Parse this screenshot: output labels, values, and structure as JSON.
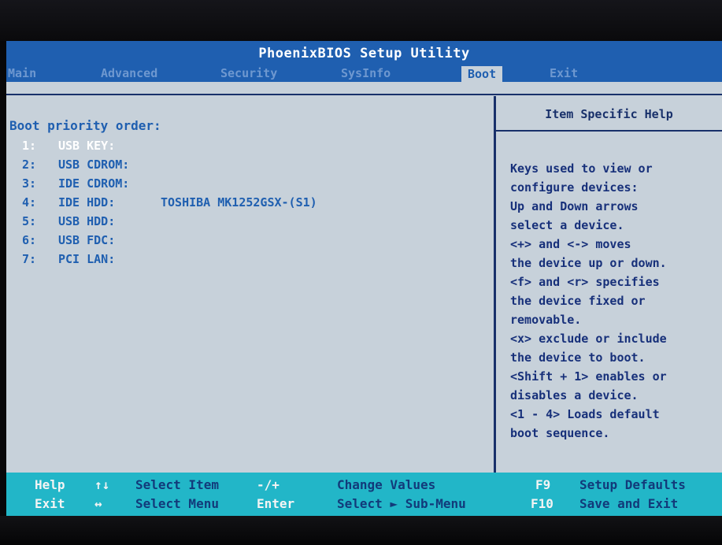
{
  "title": "PhoenixBIOS Setup Utility",
  "tabs": [
    "Main",
    "Advanced",
    "Security",
    "SysInfo",
    "Boot",
    "Exit"
  ],
  "active_tab": "Boot",
  "boot": {
    "heading": "Boot priority order:",
    "items": [
      {
        "num": "1:",
        "device": "USB KEY:",
        "detail": ""
      },
      {
        "num": "2:",
        "device": "USB CDROM:",
        "detail": ""
      },
      {
        "num": "3:",
        "device": "IDE CDROM:",
        "detail": ""
      },
      {
        "num": "4:",
        "device": "IDE HDD:",
        "detail": "TOSHIBA MK1252GSX-(S1)"
      },
      {
        "num": "5:",
        "device": "USB HDD:",
        "detail": ""
      },
      {
        "num": "6:",
        "device": "USB FDC:",
        "detail": ""
      },
      {
        "num": "7:",
        "device": "PCI LAN:",
        "detail": ""
      }
    ]
  },
  "help": {
    "title": "Item Specific Help",
    "text": "Keys used to view or\nconfigure devices:\nUp and Down arrows\nselect a device.\n<+> and <-> moves\nthe device up or down.\n<f> and <r> specifies\nthe device fixed or\nremovable.\n<x> exclude or include\nthe device to boot.\n<Shift + 1> enables or\ndisables a device.\n<1 - 4> Loads default\nboot sequence."
  },
  "footer": {
    "help": "Help",
    "exit": "Exit",
    "updown": "↑↓",
    "leftright": "↔",
    "select_item": "Select Item",
    "select_menu": "Select Menu",
    "minusplus": "-/+",
    "enter": "Enter",
    "change_values": "Change Values",
    "select_submenu": "Select ► Sub-Menu",
    "f9": "F9",
    "f10": "F10",
    "setup_defaults": "Setup Defaults",
    "save_exit": "Save and Exit"
  }
}
